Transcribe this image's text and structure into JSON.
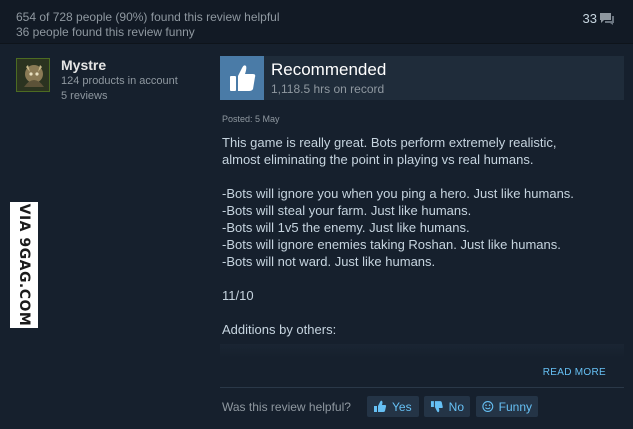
{
  "summary": {
    "helpful_text": "654 of 728 people (90%) found this review helpful",
    "funny_text": "36 people found this review funny",
    "comment_count": "33",
    "comment_icon": "speech-bubble-icon"
  },
  "author": {
    "name": "Mystre",
    "products": "124 products in account",
    "reviews": "5 reviews"
  },
  "watermark": "VIA 9GAG.COM",
  "review": {
    "verdict": "Recommended",
    "verdict_icon": "thumbs-up-icon",
    "hours": "1,118.5 hrs on record",
    "posted": "Posted: 5 May",
    "body_intro": [
      "This game is really great. Bots perform extremely realistic,",
      "almost eliminating the point in playing vs real humans."
    ],
    "body_points": [
      "-Bots will ignore you when you ping a hero. Just like humans.",
      "-Bots will steal your farm. Just like humans.",
      "-Bots will 1v5 the enemy. Just like humans.",
      "-Bots will ignore enemies taking Roshan. Just like humans.",
      "-Bots will not ward. Just like humans."
    ],
    "score": "11/10",
    "additions": "Additions by others:",
    "read_more": "READ MORE"
  },
  "feedback": {
    "question": "Was this review helpful?",
    "yes": "Yes",
    "no": "No",
    "funny": "Funny"
  },
  "colors": {
    "background": "#16202d",
    "header_background": "#121a25",
    "accent_link": "#66c0f4",
    "thumb_box": "#4a7ba7",
    "text": "#c6d4df",
    "muted": "#8f98a0"
  }
}
